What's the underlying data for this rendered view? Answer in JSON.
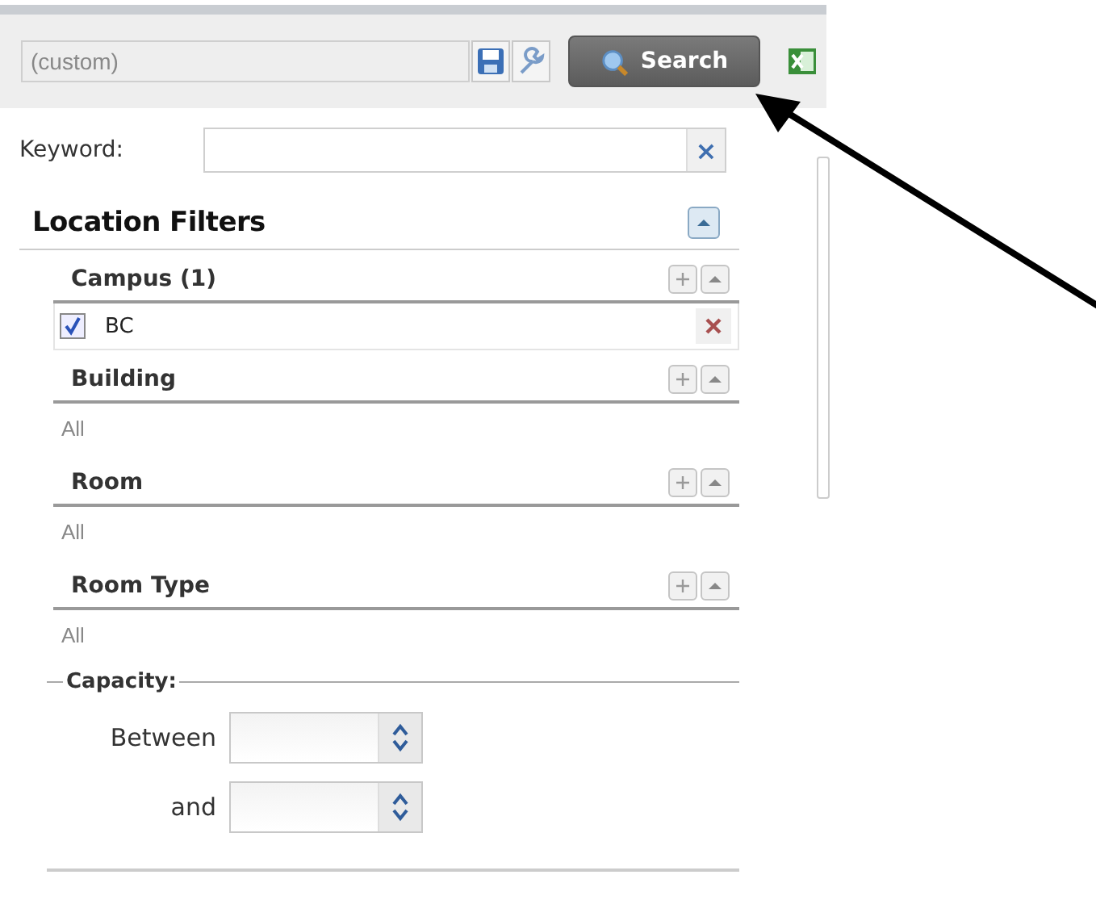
{
  "toolbar": {
    "saved_search": {
      "value": "(custom)"
    },
    "search_button": "Search"
  },
  "keyword": {
    "label": "Keyword:",
    "clear": "×"
  },
  "location_filters": {
    "title": "Location Filters",
    "expanded": true,
    "sections": [
      {
        "title": "Campus (1)",
        "items": [
          {
            "label": "BC",
            "checked": true
          }
        ]
      },
      {
        "title": "Building",
        "empty_text": "All"
      },
      {
        "title": "Room",
        "empty_text": "All"
      },
      {
        "title": "Room Type",
        "empty_text": "All"
      }
    ]
  },
  "capacity": {
    "legend": "Capacity:",
    "fields": [
      {
        "label": "Between"
      },
      {
        "label": "and"
      }
    ]
  }
}
